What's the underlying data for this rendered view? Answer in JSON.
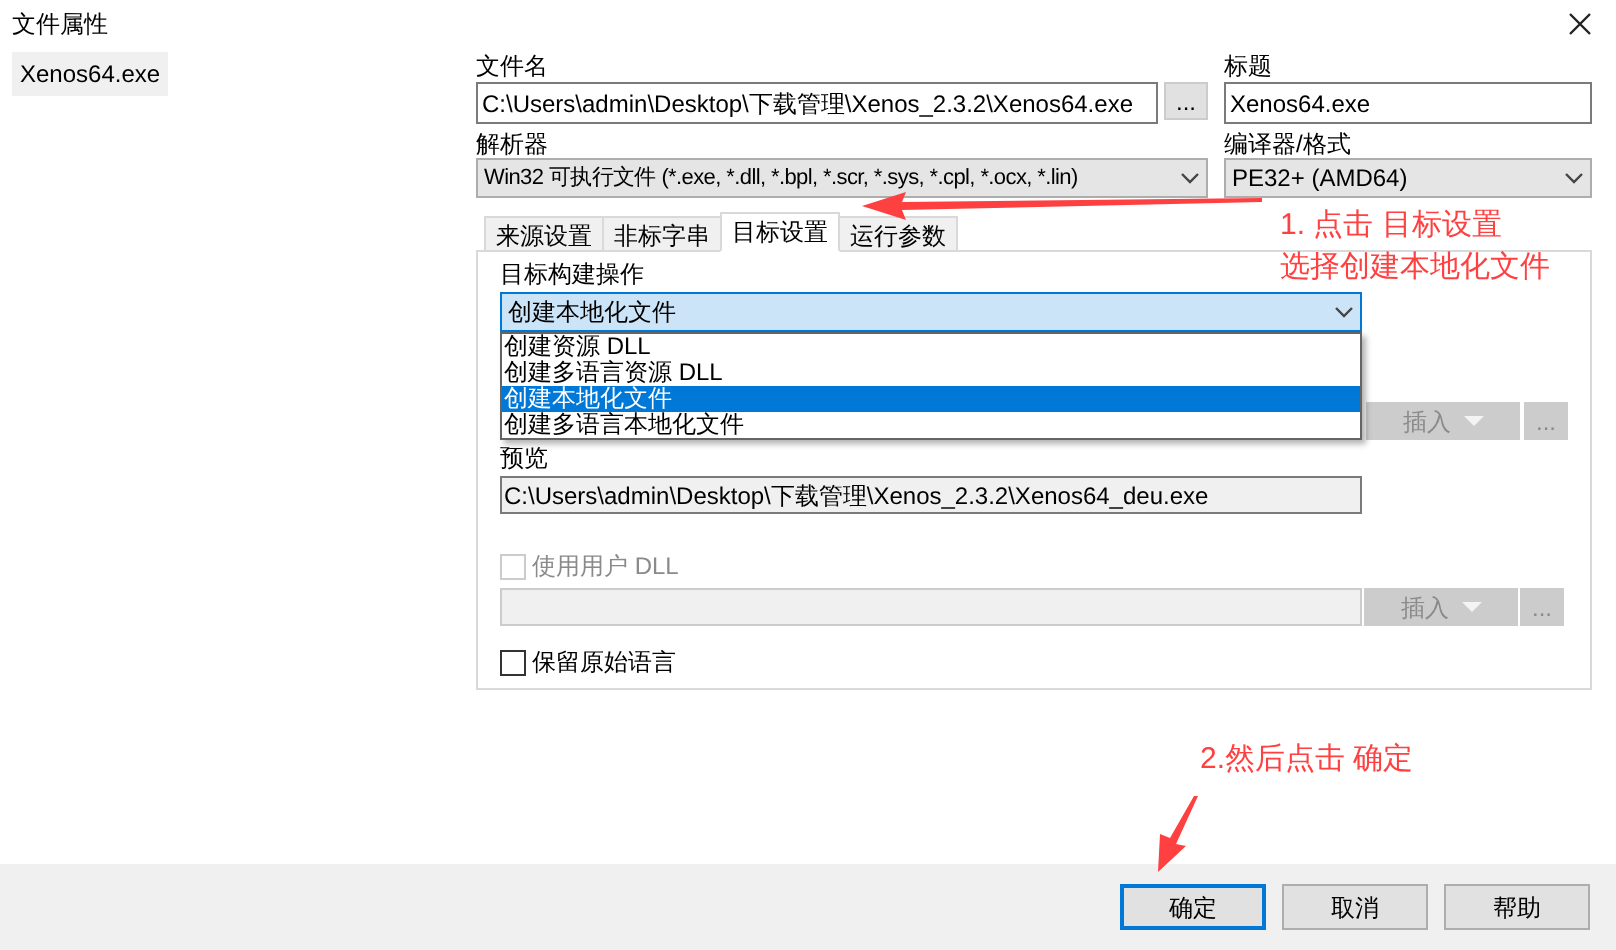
{
  "window": {
    "title": "文件属性"
  },
  "file_list": [
    {
      "name": "Xenos64.exe",
      "selected": true
    }
  ],
  "file_name": {
    "label": "文件名",
    "value": "C:\\Users\\admin\\Desktop\\下载管理\\Xenos_2.3.2\\Xenos64.exe",
    "browse": "..."
  },
  "title": {
    "label": "标题",
    "value": "Xenos64.exe"
  },
  "parser": {
    "label": "解析器",
    "value": "Win32 可执行文件 (*.exe, *.dll, *.bpl, *.scr, *.sys, *.cpl, *.ocx, *.lin)"
  },
  "compiler": {
    "label": "编译器/格式",
    "value": "PE32+ (AMD64)"
  },
  "tabs": [
    {
      "label": "来源设置",
      "selected": false
    },
    {
      "label": "非标字串",
      "selected": false
    },
    {
      "label": "目标设置",
      "selected": true
    },
    {
      "label": "运行参数",
      "selected": false
    }
  ],
  "target": {
    "label": "目标构建操作",
    "value": "创建本地化文件",
    "expanded": true,
    "options": [
      {
        "label": "创建资源 DLL",
        "selected": false
      },
      {
        "label": "创建多语言资源 DLL",
        "selected": false
      },
      {
        "label": "创建本地化文件",
        "selected": true
      },
      {
        "label": "创建多语言本地化文件",
        "selected": false
      }
    ]
  },
  "target_row": {
    "insert": "插入",
    "more": "..."
  },
  "preview": {
    "label": "预览",
    "value": "C:\\Users\\admin\\Desktop\\下载管理\\Xenos_2.3.2\\Xenos64_deu.exe"
  },
  "user_dll": {
    "label": "使用用户 DLL",
    "checked": false,
    "disabled": true,
    "insert": "插入",
    "more": "..."
  },
  "keep_original": {
    "label": "保留原始语言",
    "checked": false
  },
  "annotations": [
    {
      "text": "1. 点击 目标设置"
    },
    {
      "text": "选择创建本地化文件"
    },
    {
      "text": "2.然后点击 确定"
    }
  ],
  "buttons": [
    {
      "label": "确定",
      "focused": true
    },
    {
      "label": "取消",
      "focused": false
    },
    {
      "label": "帮助",
      "focused": false
    }
  ]
}
